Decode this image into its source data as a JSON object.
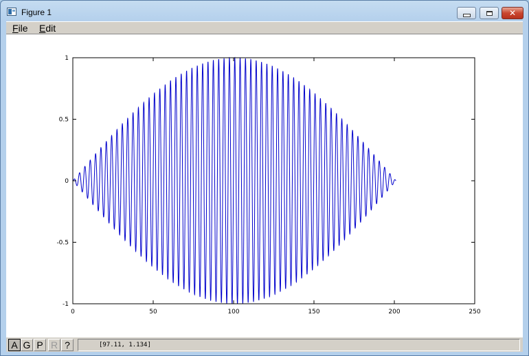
{
  "window": {
    "title": "Figure 1",
    "buttons": {
      "minimize": "minimize",
      "maximize": "maximize",
      "close": "✕"
    }
  },
  "menu": {
    "file": {
      "mnemonic": "F",
      "rest": "ile"
    },
    "edit": {
      "mnemonic": "E",
      "rest": "dit"
    }
  },
  "toolbar": {
    "tools": [
      {
        "label": "A",
        "state": "active"
      },
      {
        "label": "G",
        "state": "normal"
      },
      {
        "label": "P",
        "state": "normal"
      },
      {
        "label": "R",
        "state": "disabled"
      },
      {
        "label": "?",
        "state": "normal"
      }
    ],
    "coordinates": "[97.11, 1.134]"
  },
  "chart_data": {
    "type": "line",
    "title": "",
    "xlabel": "",
    "ylabel": "",
    "xlim": [
      0,
      250
    ],
    "ylim": [
      -1,
      1
    ],
    "xticks": [
      "0",
      "50",
      "100",
      "150",
      "200",
      "250"
    ],
    "yticks": [
      "1",
      "0.5",
      "0",
      "-0.5",
      "-1"
    ],
    "xtick_values": [
      0,
      50,
      100,
      150,
      200,
      250
    ],
    "ytick_values": [
      1,
      0.5,
      0,
      -0.5,
      -1
    ],
    "grid": false,
    "legend": "none",
    "series": [
      {
        "color": "#0000cc",
        "description": "sinusoid with half-sine envelope",
        "x_start": 0,
        "x_end": 201,
        "x_peak": 100,
        "amplitude": 1,
        "oscillation_period": 3.33
      }
    ]
  }
}
